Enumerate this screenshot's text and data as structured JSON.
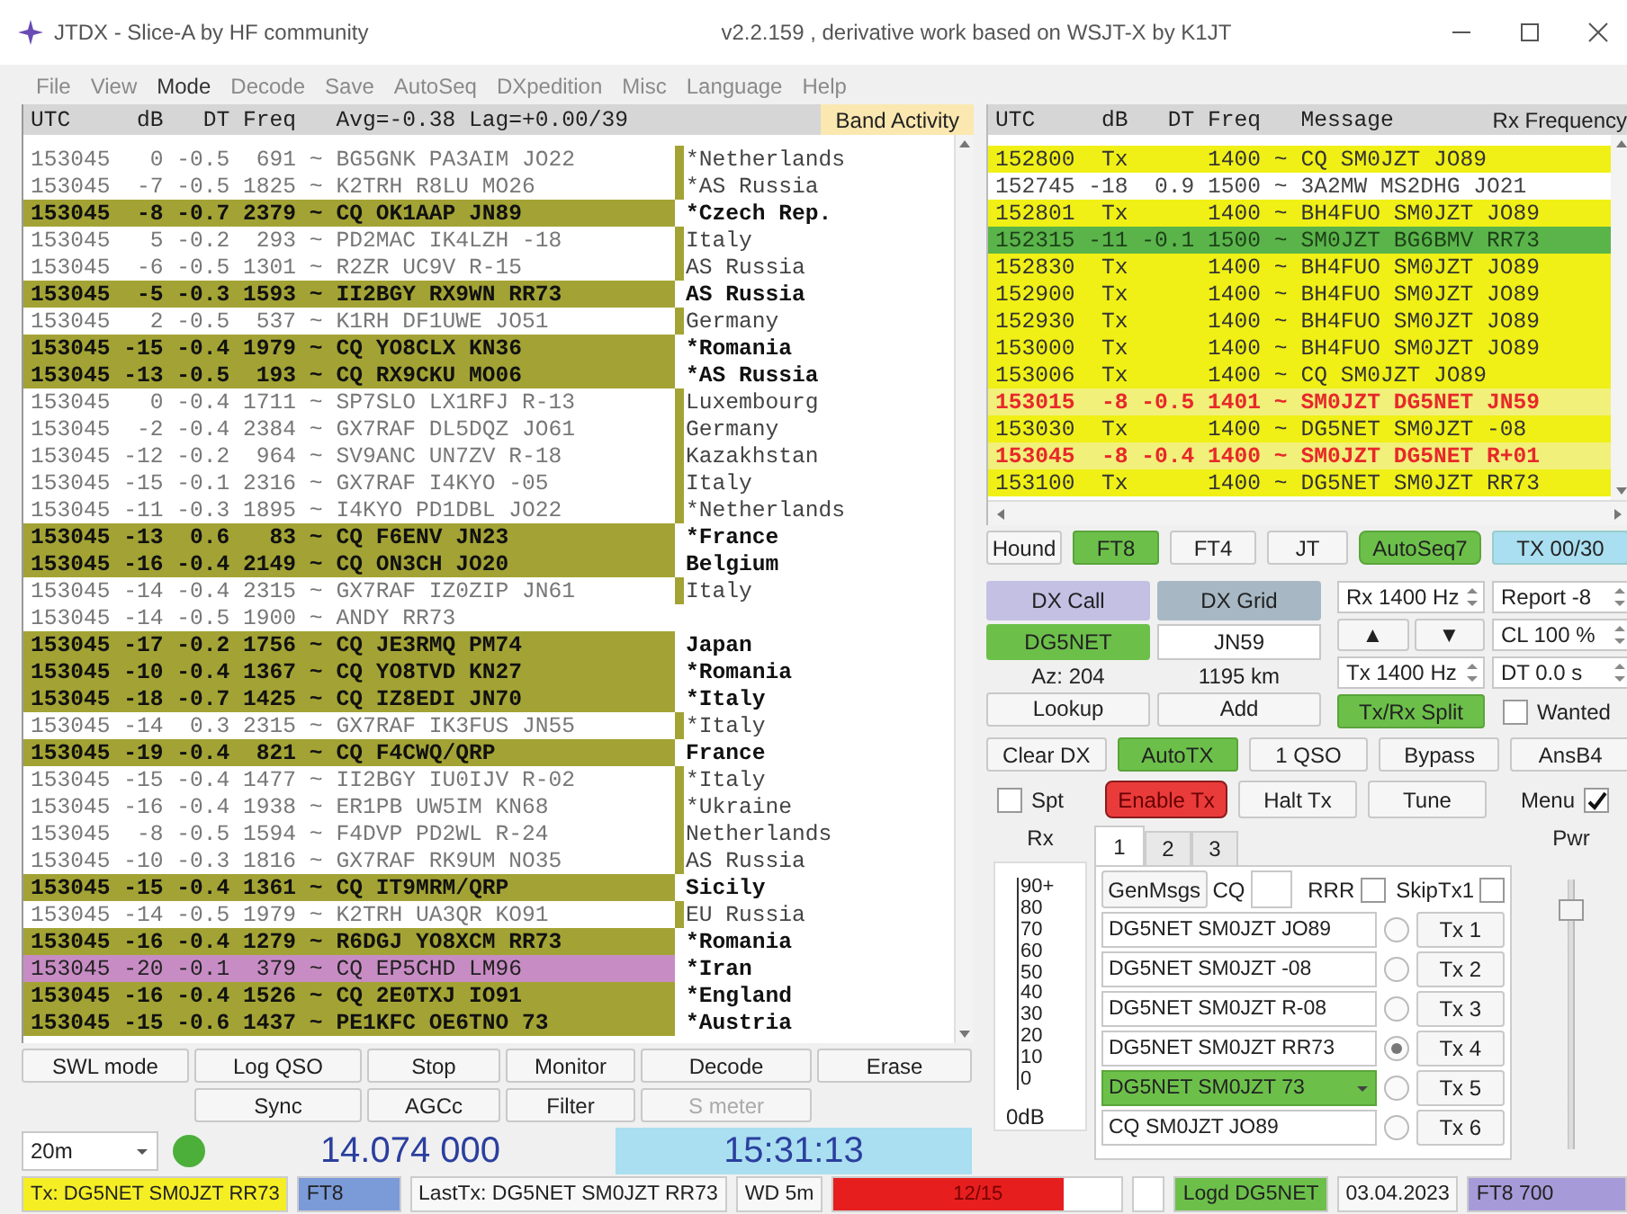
{
  "window": {
    "title": "JTDX - Slice-A  by HF community",
    "subtitle": "v2.2.159 , derivative work based on WSJT-X by K1JT"
  },
  "menu": [
    {
      "label": "File",
      "selected": false
    },
    {
      "label": "View",
      "selected": false
    },
    {
      "label": "Mode",
      "selected": true
    },
    {
      "label": "Decode",
      "selected": false
    },
    {
      "label": "Save",
      "selected": false
    },
    {
      "label": "AutoSeq",
      "selected": false
    },
    {
      "label": "DXpedition",
      "selected": false
    },
    {
      "label": "Misc",
      "selected": false
    },
    {
      "label": "Language",
      "selected": false
    },
    {
      "label": "Help",
      "selected": false
    }
  ],
  "band_activity": {
    "columns": [
      "UTC",
      "dB",
      "DT",
      "Freq"
    ],
    "stats": "Avg=-0.38 Lag=+0.00/39",
    "title": "Band Activity",
    "rows": [
      {
        "utc": "153045",
        "db": "0",
        "dt": "-0.5",
        "freq": "691",
        "mode": "~",
        "message": "BG5GNK PA3AIM JO22",
        "country": "*Netherlands",
        "kind": "plain",
        "tag": true
      },
      {
        "utc": "153045",
        "db": "-7",
        "dt": "-0.5",
        "freq": "1825",
        "mode": "~",
        "message": "K2TRH R8LU MO26",
        "country": "*AS Russia",
        "kind": "plain",
        "tag": true
      },
      {
        "utc": "153045",
        "db": "-8",
        "dt": "-0.7",
        "freq": "2379",
        "mode": "~",
        "message": "CQ OK1AAP JN89",
        "country": "*Czech Rep.",
        "kind": "cq",
        "tag": false
      },
      {
        "utc": "153045",
        "db": "5",
        "dt": "-0.2",
        "freq": "293",
        "mode": "~",
        "message": "PD2MAC IK4LZH -18",
        "country": "Italy",
        "kind": "plain",
        "tag": true
      },
      {
        "utc": "153045",
        "db": "-6",
        "dt": "-0.5",
        "freq": "1301",
        "mode": "~",
        "message": "R2ZR UC9V R-15",
        "country": "AS Russia",
        "kind": "plain",
        "tag": true
      },
      {
        "utc": "153045",
        "db": "-5",
        "dt": "-0.3",
        "freq": "1593",
        "mode": "~",
        "message": "II2BGY RX9WN RR73",
        "country": "AS Russia",
        "kind": "cq",
        "tag": false
      },
      {
        "utc": "153045",
        "db": "2",
        "dt": "-0.5",
        "freq": "537",
        "mode": "~",
        "message": "K1RH DF1UWE JO51",
        "country": "Germany",
        "kind": "plain",
        "tag": true
      },
      {
        "utc": "153045",
        "db": "-15",
        "dt": "-0.4",
        "freq": "1979",
        "mode": "~",
        "message": "CQ YO8CLX KN36",
        "country": "*Romania",
        "kind": "cq",
        "tag": false
      },
      {
        "utc": "153045",
        "db": "-13",
        "dt": "-0.5",
        "freq": "193",
        "mode": "~",
        "message": "CQ RX9CKU MO06",
        "country": "*AS Russia",
        "kind": "cq",
        "tag": false
      },
      {
        "utc": "153045",
        "db": "0",
        "dt": "-0.4",
        "freq": "1711",
        "mode": "~",
        "message": "SP7SLO LX1RFJ R-13",
        "country": "Luxembourg",
        "kind": "plain",
        "tag": true
      },
      {
        "utc": "153045",
        "db": "-2",
        "dt": "-0.4",
        "freq": "2384",
        "mode": "~",
        "message": "GX7RAF DL5DQZ JO61",
        "country": "Germany",
        "kind": "plain",
        "tag": true
      },
      {
        "utc": "153045",
        "db": "-12",
        "dt": "-0.2",
        "freq": "964",
        "mode": "~",
        "message": "SV9ANC UN7ZV R-18",
        "country": "Kazakhstan",
        "kind": "plain",
        "tag": true
      },
      {
        "utc": "153045",
        "db": "-15",
        "dt": "-0.1",
        "freq": "2316",
        "mode": "~",
        "message": "GX7RAF I4KYO -05",
        "country": "Italy",
        "kind": "plain",
        "tag": true
      },
      {
        "utc": "153045",
        "db": "-11",
        "dt": "-0.3",
        "freq": "1895",
        "mode": "~",
        "message": "I4KYO PD1DBL JO22",
        "country": "*Netherlands",
        "kind": "plain",
        "tag": true
      },
      {
        "utc": "153045",
        "db": "-13",
        "dt": "0.6",
        "freq": "83",
        "mode": "~",
        "message": "CQ F6ENV JN23",
        "country": "*France",
        "kind": "cq",
        "tag": false
      },
      {
        "utc": "153045",
        "db": "-16",
        "dt": "-0.4",
        "freq": "2149",
        "mode": "~",
        "message": "CQ ON3CH JO20",
        "country": "Belgium",
        "kind": "cq",
        "tag": false
      },
      {
        "utc": "153045",
        "db": "-14",
        "dt": "-0.4",
        "freq": "2315",
        "mode": "~",
        "message": "GX7RAF IZ0ZIP JN61",
        "country": "Italy",
        "kind": "plain",
        "tag": true
      },
      {
        "utc": "153045",
        "db": "-14",
        "dt": "-0.5",
        "freq": "1900",
        "mode": "~",
        "message": "ANDY RR73",
        "kind": "plain",
        "tag": false
      },
      {
        "utc": "153045",
        "db": "-17",
        "dt": "-0.2",
        "freq": "1756",
        "mode": "~",
        "message": "CQ JE3RMQ PM74",
        "country": "Japan",
        "kind": "cq",
        "tag": false
      },
      {
        "utc": "153045",
        "db": "-10",
        "dt": "-0.4",
        "freq": "1367",
        "mode": "~",
        "message": "CQ YO8TVD KN27",
        "country": "*Romania",
        "kind": "cq",
        "tag": false
      },
      {
        "utc": "153045",
        "db": "-18",
        "dt": "-0.7",
        "freq": "1425",
        "mode": "~",
        "message": "CQ IZ8EDI JN70",
        "country": "*Italy",
        "kind": "cq",
        "tag": false
      },
      {
        "utc": "153045",
        "db": "-14",
        "dt": "0.3",
        "freq": "2315",
        "mode": "~",
        "message": "GX7RAF IK3FUS JN55",
        "country": "*Italy",
        "kind": "plain",
        "tag": true
      },
      {
        "utc": "153045",
        "db": "-19",
        "dt": "-0.4",
        "freq": "821",
        "mode": "~",
        "message": "CQ F4CWQ/QRP",
        "country": "France",
        "kind": "cq",
        "tag": false
      },
      {
        "utc": "153045",
        "db": "-15",
        "dt": "-0.4",
        "freq": "1477",
        "mode": "~",
        "message": "II2BGY IU0IJV R-02",
        "country": "*Italy",
        "kind": "plain",
        "tag": true
      },
      {
        "utc": "153045",
        "db": "-16",
        "dt": "-0.4",
        "freq": "1938",
        "mode": "~",
        "message": "ER1PB UW5IM KN68",
        "country": "*Ukraine",
        "kind": "plain",
        "tag": true
      },
      {
        "utc": "153045",
        "db": "-8",
        "dt": "-0.5",
        "freq": "1594",
        "mode": "~",
        "message": "F4DVP PD2WL R-24",
        "country": "Netherlands",
        "kind": "plain",
        "tag": true
      },
      {
        "utc": "153045",
        "db": "-10",
        "dt": "-0.3",
        "freq": "1816",
        "mode": "~",
        "message": "GX7RAF RK9UM NO35",
        "country": "AS Russia",
        "kind": "plain",
        "tag": true
      },
      {
        "utc": "153045",
        "db": "-15",
        "dt": "-0.4",
        "freq": "1361",
        "mode": "~",
        "message": "CQ IT9MRM/QRP",
        "country": "Sicily",
        "kind": "cq",
        "tag": false
      },
      {
        "utc": "153045",
        "db": "-14",
        "dt": "-0.5",
        "freq": "1979",
        "mode": "~",
        "message": "K2TRH UA3QR KO91",
        "country": "EU Russia",
        "kind": "plain",
        "tag": true
      },
      {
        "utc": "153045",
        "db": "-16",
        "dt": "-0.4",
        "freq": "1279",
        "mode": "~",
        "message": "R6DGJ YO8XCM RR73",
        "country": "*Romania",
        "kind": "cq",
        "tag": false
      },
      {
        "utc": "153045",
        "db": "-20",
        "dt": "-0.1",
        "freq": "379",
        "mode": "~",
        "message": "CQ EP5CHD LM96",
        "country": "*Iran",
        "kind": "alert",
        "tag": false
      },
      {
        "utc": "153045",
        "db": "-16",
        "dt": "-0.4",
        "freq": "1526",
        "mode": "~",
        "message": "CQ 2E0TXJ IO91",
        "country": "*England",
        "kind": "cq",
        "tag": false
      },
      {
        "utc": "153045",
        "db": "-15",
        "dt": "-0.6",
        "freq": "1437",
        "mode": "~",
        "message": "PE1KFC OE6TNO 73",
        "country": "*Austria",
        "kind": "cq",
        "tag": false
      }
    ]
  },
  "rx_frequency": {
    "columns": [
      "UTC",
      "dB",
      "DT",
      "Freq",
      "Message"
    ],
    "title": "Rx Frequency",
    "rows": [
      {
        "utc": "152800",
        "db": "Tx",
        "freq": "1400",
        "mode": "~",
        "message": "CQ SM0JZT JO89",
        "kind": "tx"
      },
      {
        "utc": "152745",
        "db": "-18",
        "dt": "0.9",
        "freq": "1500",
        "mode": "~",
        "message": "3A2MW MS2DHG JO21",
        "kind": "rx"
      },
      {
        "utc": "152801",
        "db": "Tx",
        "freq": "1400",
        "mode": "~",
        "message": "BH4FUO SM0JZT JO89",
        "kind": "tx"
      },
      {
        "utc": "152315",
        "db": "-11",
        "dt": "-0.1",
        "freq": "1500",
        "mode": "~",
        "message": "SM0JZT BG6BMV RR73",
        "kind": "struck"
      },
      {
        "utc": "152830",
        "db": "Tx",
        "freq": "1400",
        "mode": "~",
        "message": "BH4FUO SM0JZT JO89",
        "kind": "tx"
      },
      {
        "utc": "152900",
        "db": "Tx",
        "freq": "1400",
        "mode": "~",
        "message": "BH4FUO SM0JZT JO89",
        "kind": "tx"
      },
      {
        "utc": "152930",
        "db": "Tx",
        "freq": "1400",
        "mode": "~",
        "message": "BH4FUO SM0JZT JO89",
        "kind": "tx"
      },
      {
        "utc": "153000",
        "db": "Tx",
        "freq": "1400",
        "mode": "~",
        "message": "BH4FUO SM0JZT JO89",
        "kind": "tx"
      },
      {
        "utc": "153006",
        "db": "Tx",
        "freq": "1400",
        "mode": "~",
        "message": "CQ SM0JZT JO89",
        "kind": "tx"
      },
      {
        "utc": "153015",
        "db": "-8",
        "dt": "-0.5",
        "freq": "1401",
        "mode": "~",
        "message": "SM0JZT DG5NET JN59",
        "kind": "call"
      },
      {
        "utc": "153030",
        "db": "Tx",
        "freq": "1400",
        "mode": "~",
        "message": "DG5NET SM0JZT -08",
        "kind": "tx"
      },
      {
        "utc": "153045",
        "db": "-8",
        "dt": "-0.4",
        "freq": "1400",
        "mode": "~",
        "message": "SM0JZT DG5NET R+01",
        "kind": "call"
      },
      {
        "utc": "153100",
        "db": "Tx",
        "freq": "1400",
        "mode": "~",
        "message": "DG5NET SM0JZT RR73",
        "kind": "tx"
      }
    ]
  },
  "mode_buttons": [
    {
      "label": "Hound",
      "kind": "toggle",
      "on": false
    },
    {
      "label": "FT8",
      "kind": "toggle",
      "on": true
    },
    {
      "label": "FT4",
      "kind": "toggle",
      "on": false
    },
    {
      "label": "JT",
      "kind": "toggle",
      "on": false
    },
    {
      "label": "AutoSeq7",
      "kind": "toggle",
      "on": true
    },
    {
      "label": "TX 00/30",
      "kind": "status",
      "on": false
    }
  ],
  "dx": {
    "call_label": "DX Call",
    "grid_label": "DX Grid",
    "call": "DG5NET",
    "grid": "JN59",
    "azimuth": "Az: 204",
    "distance": "1195 km",
    "lookup": "Lookup",
    "add": "Add"
  },
  "frequency": {
    "rx": "Rx  1400  Hz",
    "report": "Report -8",
    "up": "▲",
    "down": "▼",
    "cl": "CL  100 %",
    "tx": "Tx  1400  Hz",
    "dt": "DT 0.0 s",
    "split": {
      "label": "Tx/Rx Split",
      "on": true
    },
    "wanted": {
      "label": "Wanted",
      "checked": false
    }
  },
  "action_buttons": [
    {
      "label": "Clear DX",
      "on": false
    },
    {
      "label": "AutoTX",
      "on": true
    },
    {
      "label": "1 QSO",
      "on": false
    },
    {
      "label": "Bypass",
      "on": false
    },
    {
      "label": "AnsB4",
      "on": false
    }
  ],
  "tx_controls": [
    {
      "kind": "checkbox",
      "label": "Spt",
      "checked": false
    },
    {
      "kind": "enable",
      "label": "Enable Tx",
      "on": true
    },
    {
      "kind": "button",
      "label": "Halt Tx"
    },
    {
      "kind": "button",
      "label": "Tune"
    },
    {
      "kind": "checkbox",
      "label": "Menu",
      "checked": true
    }
  ],
  "meter": {
    "label": "Rx",
    "ticks": [
      "90+",
      "80",
      "70",
      "60",
      "50",
      "40",
      "30",
      "20",
      "10",
      "0"
    ],
    "unit": "0dB"
  },
  "tabs": [
    {
      "label": "1",
      "selected": true
    },
    {
      "label": "2",
      "selected": false
    },
    {
      "label": "3",
      "selected": false
    }
  ],
  "generate": {
    "button": "GenMsgs",
    "cq_label": "CQ",
    "rrr": {
      "label": "RRR",
      "checked": false
    },
    "skip": {
      "label": "SkipTx1",
      "checked": false
    }
  },
  "messages": [
    {
      "text": "DG5NET SM0JZT JO89",
      "kind": "field",
      "selected": false,
      "button": "Tx 1"
    },
    {
      "text": "DG5NET SM0JZT -08",
      "kind": "field",
      "selected": false,
      "button": "Tx 2"
    },
    {
      "text": "DG5NET SM0JZT R-08",
      "kind": "field",
      "selected": false,
      "button": "Tx 3"
    },
    {
      "text": "DG5NET SM0JZT RR73",
      "kind": "field",
      "selected": true,
      "button": "Tx 4"
    },
    {
      "text": "DG5NET SM0JZT 73",
      "kind": "dropdown",
      "selected": false,
      "button": "Tx 5"
    },
    {
      "text": "CQ SM0JZT JO89",
      "kind": "field",
      "selected": false,
      "button": "Tx 6"
    }
  ],
  "power": {
    "label": "Pwr",
    "level": 0.92
  },
  "bottom_buttons": [
    {
      "label": "SWL mode",
      "disabled": false
    },
    {
      "label": "Log QSO",
      "disabled": false
    },
    {
      "label": "Stop",
      "disabled": false
    },
    {
      "label": "Monitor",
      "disabled": false
    },
    {
      "label": "Decode",
      "disabled": false
    },
    {
      "label": "Erase",
      "disabled": false
    }
  ],
  "bottom_buttons_2": [
    {
      "label": "Sync",
      "disabled": false
    },
    {
      "label": "AGCc",
      "disabled": false
    },
    {
      "label": "Filter",
      "disabled": false
    },
    {
      "label": "S meter",
      "disabled": true
    }
  ],
  "band": {
    "value": "20m",
    "dial": "14.074 000",
    "clock": "15:31:13",
    "receiving": true
  },
  "status_bar": [
    {
      "kind": "tx",
      "text": "Tx: DG5NET SM0JZT RR73"
    },
    {
      "kind": "mode",
      "text": "FT8"
    },
    {
      "kind": "plain",
      "text": "LastTx: DG5NET SM0JZT RR73"
    },
    {
      "kind": "plain",
      "text": "WD 5m"
    },
    {
      "kind": "progress",
      "text": "12/15",
      "level": 0.8
    },
    {
      "kind": "blank"
    },
    {
      "kind": "logged",
      "text": "Logd DG5NET"
    },
    {
      "kind": "plain",
      "text": "03.04.2023"
    },
    {
      "kind": "submode",
      "text": "FT8  700"
    }
  ]
}
